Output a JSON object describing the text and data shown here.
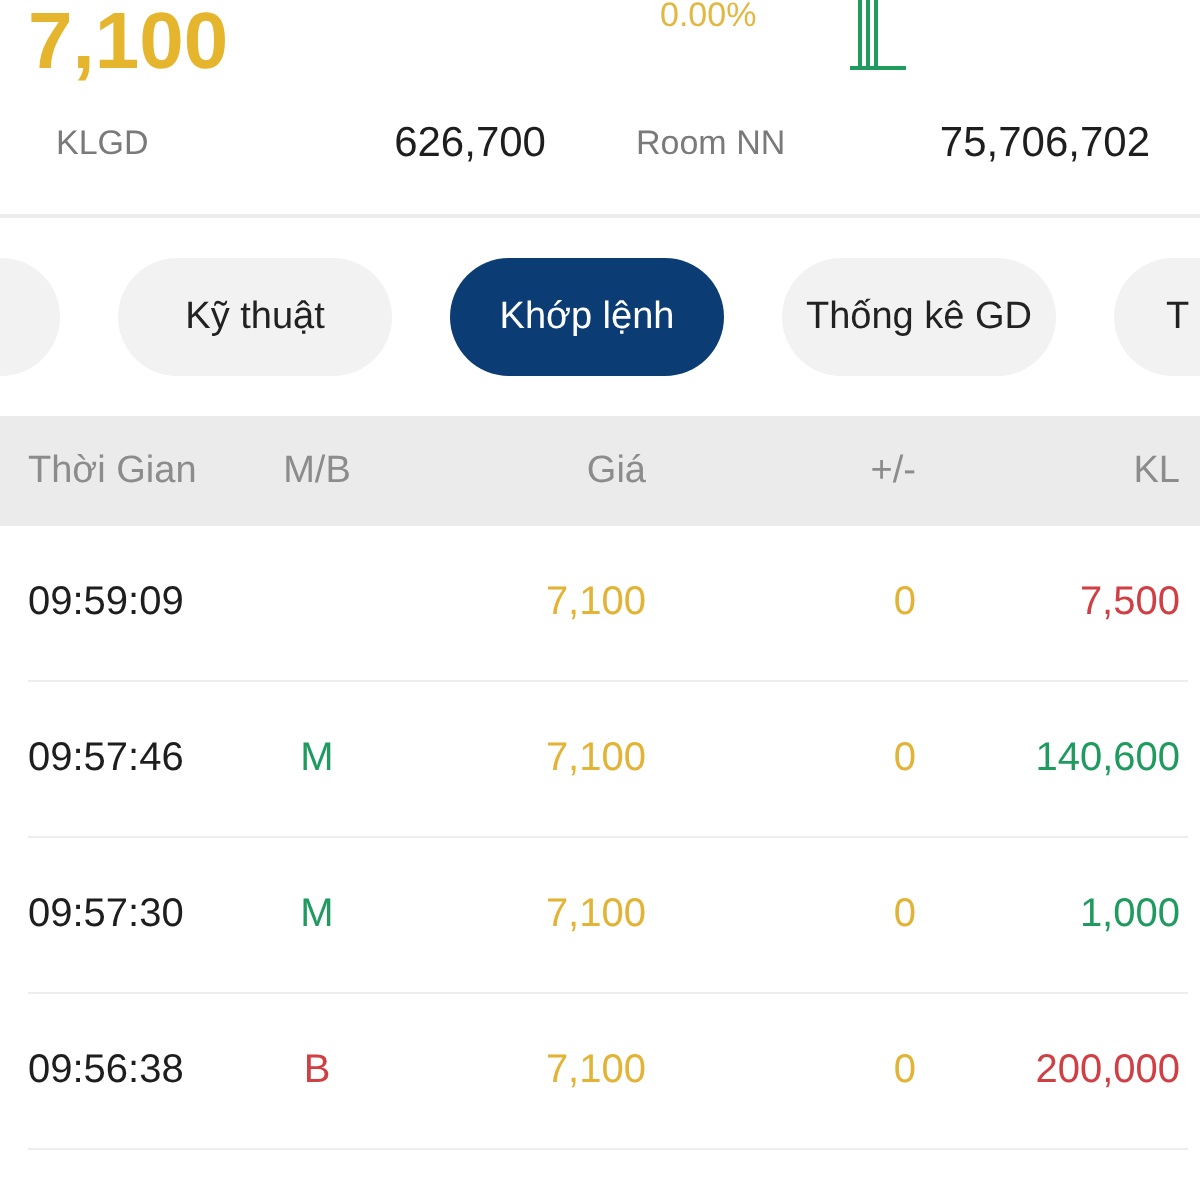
{
  "quote": {
    "price": "7,100",
    "change_percent": "0.00%"
  },
  "stats": [
    {
      "label": "KLGD",
      "value": "626,700"
    },
    {
      "label": "Room NN",
      "value": "75,706,702"
    }
  ],
  "tabs": [
    {
      "selected": false
    },
    {
      "label": "Kỹ thuật",
      "selected": false
    },
    {
      "label": "Khớp lệnh",
      "selected": true
    },
    {
      "label": "Thống kê GD",
      "selected": false
    },
    {
      "label": "T",
      "selected": false
    }
  ],
  "table": {
    "columns": [
      "Thời Gian",
      "M/B",
      "Giá",
      "+/-",
      "KL"
    ],
    "rows": [
      {
        "time": "09:59:09",
        "price": "7,100",
        "change": "0",
        "volume": "7,500",
        "color": "#cf3f44"
      },
      {
        "time": "09:57:46",
        "side": "M",
        "price": "7,100",
        "change": "0",
        "volume": "140,600",
        "color": "#1f9b5f"
      },
      {
        "time": "09:57:30",
        "side": "M",
        "price": "7,100",
        "change": "0",
        "volume": "1,000",
        "color": "#1f9b5f"
      },
      {
        "time": "09:56:38",
        "side": "B",
        "price": "7,100",
        "change": "0",
        "volume": "200,000",
        "color": "#cf3f44"
      }
    ]
  }
}
